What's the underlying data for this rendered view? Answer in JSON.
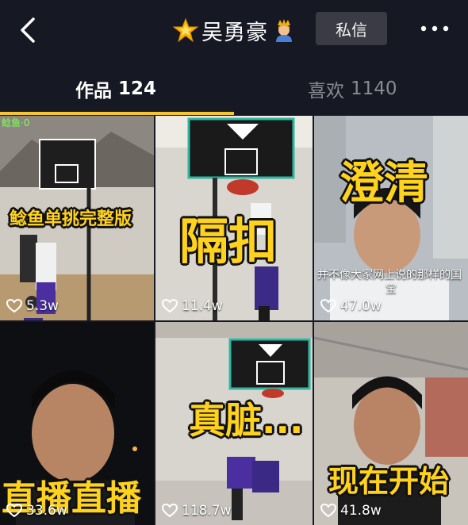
{
  "header": {
    "back_icon": "chevron-left-icon",
    "star_emoji": "glowing-star-icon",
    "name": "吴勇豪",
    "crown_emoji": "prince-icon",
    "message_label": "私信",
    "more_icon": "more-horizontal-icon"
  },
  "tabs": [
    {
      "label": "作品",
      "count": "124",
      "active": true
    },
    {
      "label": "喜欢",
      "count": "1140",
      "active": false
    }
  ],
  "videos": [
    {
      "overlay": "鲶鱼单挑完整版",
      "likes": "5.3w",
      "tag": "鲶鱼·0"
    },
    {
      "overlay": "隔扣",
      "likes": "11.4w"
    },
    {
      "overlay": "澄清",
      "subtitle": "并不像大家网上说的那样的国",
      "subtitle2": "宝",
      "likes": "47.0w"
    },
    {
      "overlay": "直播直播",
      "likes": "33.6w"
    },
    {
      "overlay": "真脏...",
      "likes": "118.7w"
    },
    {
      "overlay": "现在开始",
      "likes": "41.8w"
    }
  ],
  "colors": {
    "background": "#161823",
    "accent": "#f5c531",
    "overlay_text": "#ffd21e"
  }
}
